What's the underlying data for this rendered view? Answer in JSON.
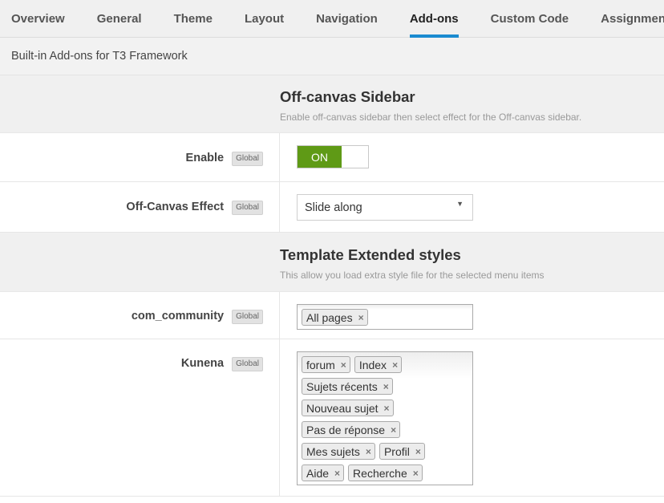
{
  "tabs": [
    "Overview",
    "General",
    "Theme",
    "Layout",
    "Navigation",
    "Add-ons",
    "Custom Code",
    "Assignment"
  ],
  "active_tab": "Add-ons",
  "subheader": "Built-in Add-ons for T3 Framework",
  "offcanvas": {
    "title": "Off-canvas Sidebar",
    "description": "Enable off-canvas sidebar then select effect for the Off-canvas sidebar.",
    "enable_label": "Enable",
    "enable_badge": "Global",
    "toggle_text": "ON",
    "effect_label": "Off-Canvas Effect",
    "effect_badge": "Global",
    "effect_value": "Slide along"
  },
  "extended": {
    "title": "Template Extended styles",
    "description": "This allow you load extra style file for the selected menu items",
    "community_label": "com_community",
    "community_badge": "Global",
    "community_tags": [
      "All pages"
    ],
    "kunena_label": "Kunena",
    "kunena_badge": "Global",
    "kunena_lines": [
      [
        "forum",
        "Index"
      ],
      [
        "Sujets récents"
      ],
      [
        "Nouveau sujet"
      ],
      [
        "Pas de réponse"
      ],
      [
        "Mes sujets",
        "Profil"
      ],
      [
        "Aide",
        "Recherche"
      ]
    ]
  },
  "icons": {
    "remove": "×",
    "caret": "▼"
  },
  "colors": {
    "accent": "#1a8bd0",
    "toggle_on": "#5f9a16"
  }
}
